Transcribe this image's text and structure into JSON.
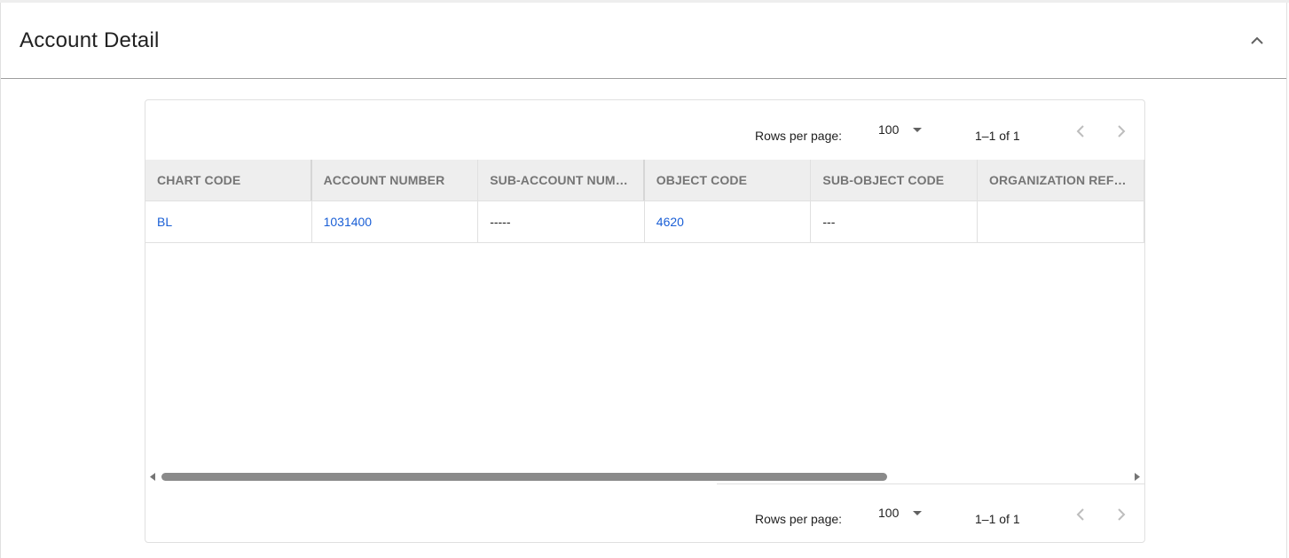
{
  "panel": {
    "title": "Account Detail",
    "collapse_icon": "chevron-up-icon"
  },
  "pagination": {
    "rows_per_page_label": "Rows per page:",
    "rows_per_page_value": "100",
    "range": "1–1 of 1",
    "prev_icon": "chevron-left-icon",
    "next_icon": "chevron-right-icon"
  },
  "table": {
    "columns": [
      "CHART CODE",
      "ACCOUNT NUMBER",
      "SUB-ACCOUNT NUMB…",
      "OBJECT CODE",
      "SUB-OBJECT CODE",
      "ORGANIZATION REFE…"
    ],
    "rows": [
      [
        "BL",
        "1031400",
        "-----",
        "4620",
        "---",
        ""
      ]
    ]
  },
  "colors": {
    "link": "#1a5fd6",
    "header_bg": "#eeeeee",
    "header_text": "#757575",
    "scroll_thumb": "#8a8a8a"
  }
}
